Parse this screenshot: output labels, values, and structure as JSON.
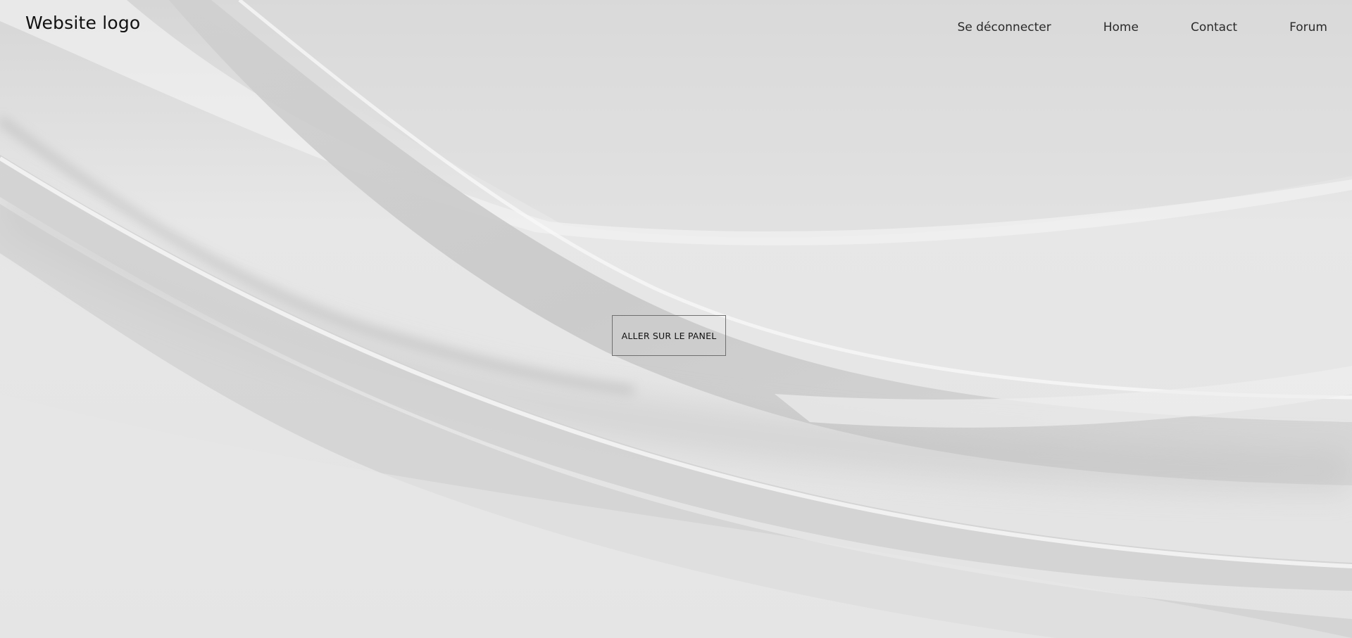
{
  "header": {
    "logo_text": "Website logo",
    "nav": [
      {
        "label": "Se déconnecter"
      },
      {
        "label": "Home"
      },
      {
        "label": "Contact"
      },
      {
        "label": "Forum"
      }
    ]
  },
  "hero": {
    "button_label": "ALLER SUR LE PANEL"
  },
  "colors": {
    "background": "#e6e6e6",
    "text": "#111111",
    "button_border": "#6f6f6f"
  }
}
